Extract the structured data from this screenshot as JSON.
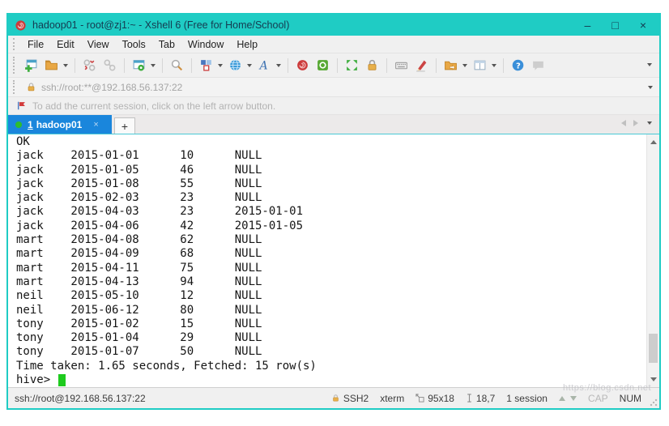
{
  "window": {
    "title": "hadoop01 - root@zj1:~ - Xshell 6 (Free for Home/School)",
    "controls": {
      "minimize": "–",
      "maximize": "□",
      "close": "×"
    }
  },
  "menu": {
    "items": [
      "File",
      "Edit",
      "View",
      "Tools",
      "Tab",
      "Window",
      "Help"
    ]
  },
  "toolbar": {
    "icons": [
      "new-session",
      "open-folder",
      "disconnect",
      "reconnect",
      "session-properties",
      "find",
      "color-scheme",
      "encoding-globe",
      "font",
      "xagent",
      "xftp",
      "fullscreen",
      "lock-screen",
      "virtual-keyboard",
      "compose",
      "folder-transfer",
      "tile-windows",
      "help",
      "feedback"
    ]
  },
  "address_bar": {
    "url": "ssh://root:**@192.168.56.137:22"
  },
  "info_bar": {
    "message": "To add the current session, click on the left arrow button."
  },
  "tab_bar": {
    "active_tab": {
      "index": "1",
      "label": "hadoop01",
      "close": "×"
    },
    "new_tab": "+"
  },
  "terminal": {
    "lines": [
      "OK",
      "jack    2015-01-01      10      NULL",
      "jack    2015-01-05      46      NULL",
      "jack    2015-01-08      55      NULL",
      "jack    2015-02-03      23      NULL",
      "jack    2015-04-03      23      2015-01-01",
      "jack    2015-04-06      42      2015-01-05",
      "mart    2015-04-08      62      NULL",
      "mart    2015-04-09      68      NULL",
      "mart    2015-04-11      75      NULL",
      "mart    2015-04-13      94      NULL",
      "neil    2015-05-10      12      NULL",
      "neil    2015-06-12      80      NULL",
      "tony    2015-01-02      15      NULL",
      "tony    2015-01-04      29      NULL",
      "tony    2015-01-07      50      NULL",
      "Time taken: 1.65 seconds, Fetched: 15 row(s)"
    ],
    "prompt": "hive> "
  },
  "status_bar": {
    "url": "ssh://root@192.168.56.137:22",
    "protocol": "SSH2",
    "terminal_type": "xterm",
    "screen_size": "95x18",
    "cursor_position": "18,7",
    "session_count": "1 session",
    "caps_indicator": "CAP",
    "num_indicator": "NUM",
    "watermark": "https://blog.csdn.net"
  }
}
